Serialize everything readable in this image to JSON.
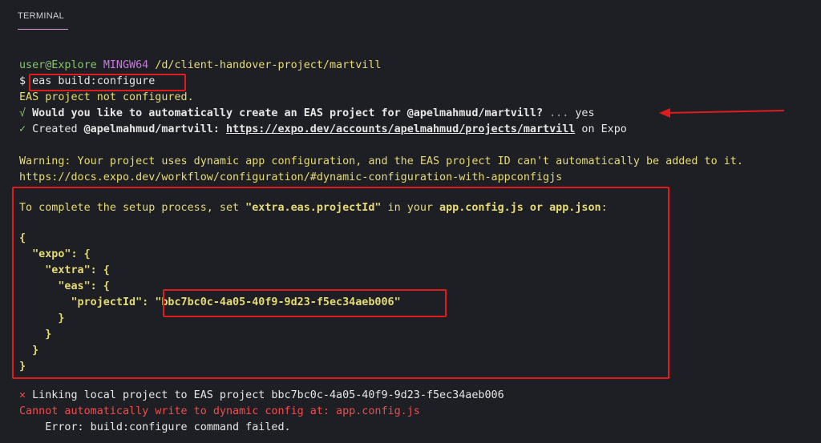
{
  "panel": {
    "tab_label": "TERMINAL"
  },
  "terminal": {
    "prompt_user": "user@Explore",
    "prompt_env": "MINGW64",
    "prompt_path": "/d/client-handover-project/martvill",
    "prompt_symbol": "$",
    "command": "eas build:configure",
    "not_configured": "EAS project not configured.",
    "question_check": "√",
    "question": "Would you like to automatically create an EAS project for @apelmahmud/martvill?",
    "question_dots": "...",
    "question_answer": "yes",
    "created_check": "✓",
    "created_prefix": "Created",
    "created_name": "@apelmahmud/martvill:",
    "created_url": "https://expo.dev/accounts/apelmahmud/projects/martvill",
    "created_suffix": "on Expo",
    "warning": "Warning: Your project uses dynamic app configuration, and the EAS project ID can't automatically be added to it.",
    "docs_url": "https://docs.expo.dev/workflow/configuration/#dynamic-configuration-with-appconfigjs",
    "setup_prefix": "To complete the setup process, set",
    "setup_key": "\"extra.eas.projectId\"",
    "setup_mid": "in your",
    "setup_files": "app.config.js or app.json",
    "setup_colon": ":",
    "json_open": "{",
    "json_expo": "  \"expo\": {",
    "json_extra": "    \"extra\": {",
    "json_eas": "      \"eas\": {",
    "json_projectid_key": "        \"projectId\":",
    "json_projectid_value": "\"bbc7bc0c-4a05-40f9-9d23-f5ec34aeb006\"",
    "json_close4": "      }",
    "json_close3": "    }",
    "json_close2": "  }",
    "json_close1": "}",
    "link_x": "✕",
    "link_text": "Linking local project to EAS project bbc7bc0c-4a05-40f9-9d23-f5ec34aeb006",
    "cannot_write": "Cannot automatically write to dynamic config at: app.config.js",
    "error_line": "    Error: build:configure command failed."
  },
  "colors": {
    "background": "#1e1f24",
    "highlight_box": "#e01b1b",
    "green": "#85c46b",
    "yellow": "#e6db74",
    "red": "#f14c4c",
    "magenta": "#c678dd"
  }
}
